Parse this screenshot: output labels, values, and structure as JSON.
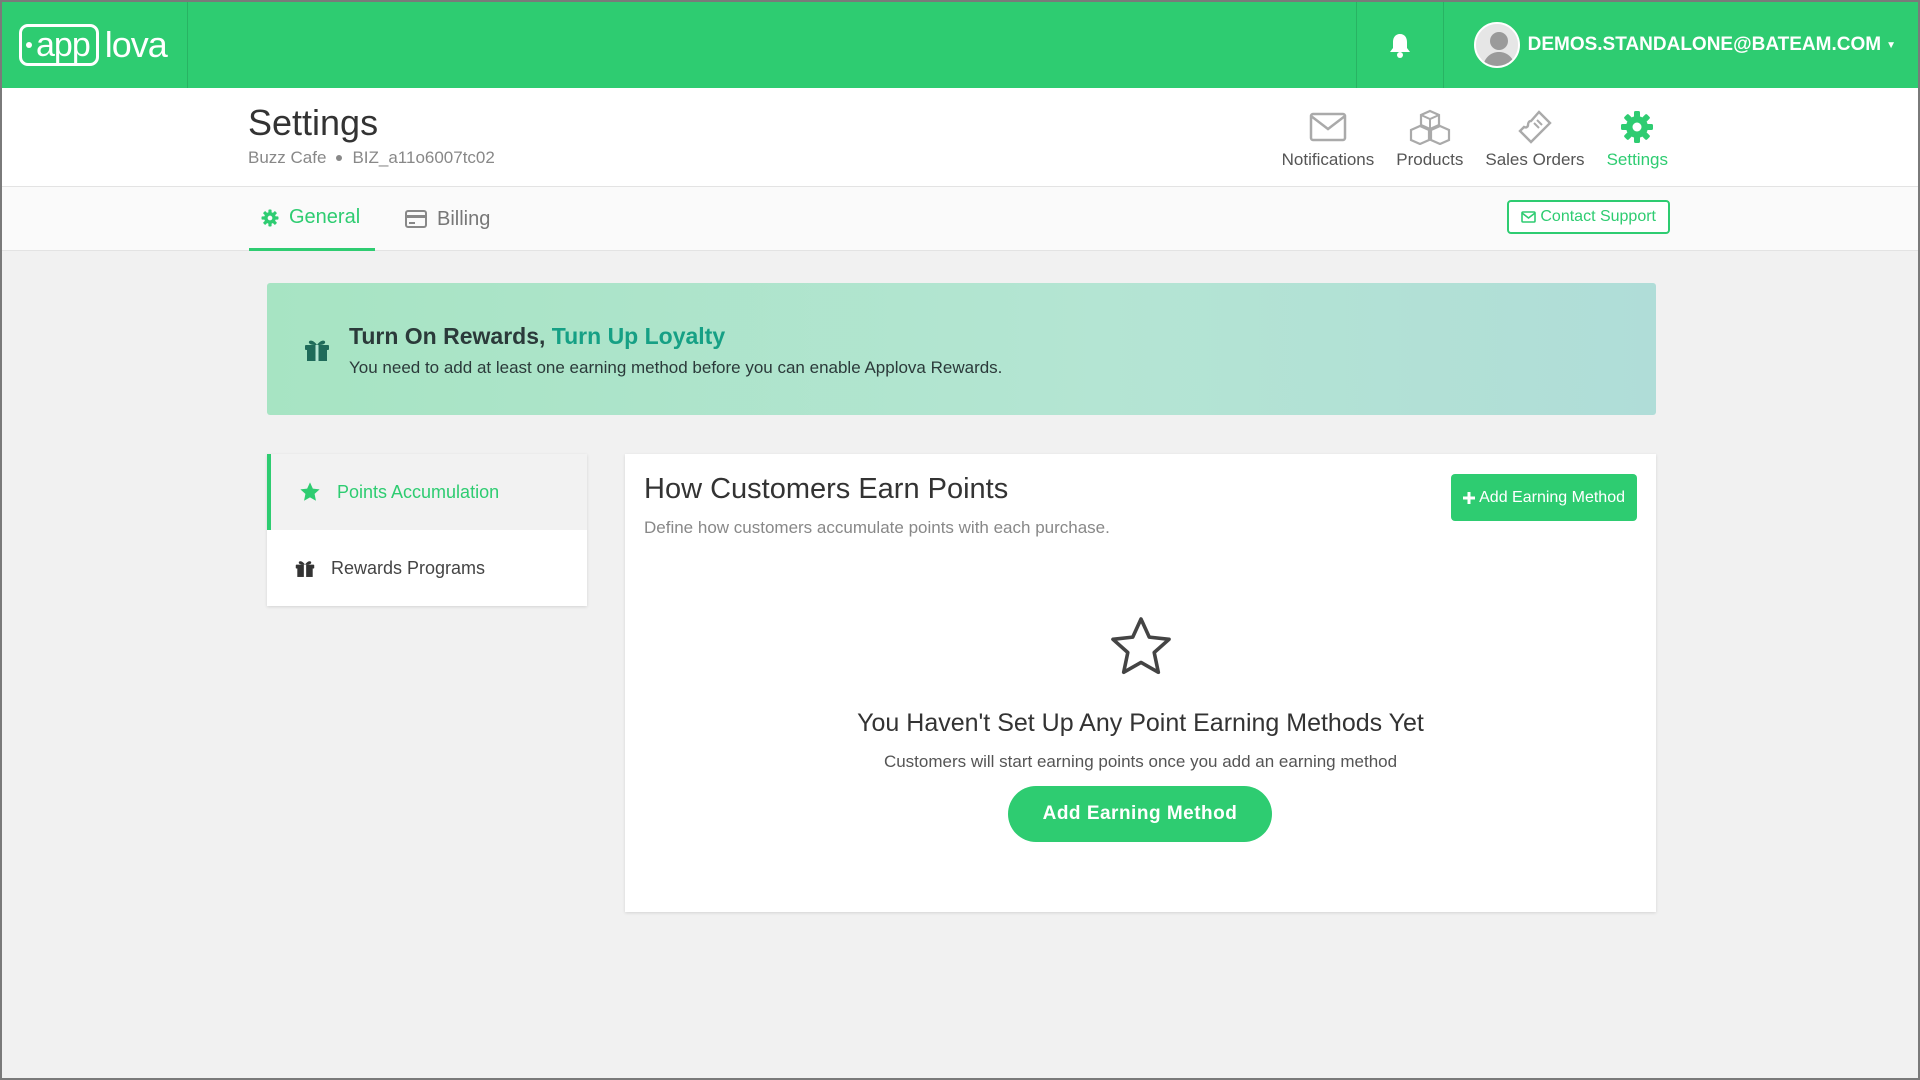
{
  "brand": {
    "logo_app": "app",
    "logo_lova": "lova",
    "color": "#2ecc71"
  },
  "topbar": {
    "user_email": "DEMOS.STANDALONE@BATEAM.COM"
  },
  "header": {
    "title": "Settings",
    "business_name": "Buzz Cafe",
    "business_id": "BIZ_a11o6007tc02",
    "nav": [
      {
        "label": "Notifications",
        "icon": "envelope-icon"
      },
      {
        "label": "Products",
        "icon": "boxes-icon"
      },
      {
        "label": "Sales Orders",
        "icon": "ticket-icon"
      },
      {
        "label": "Settings",
        "icon": "gear-icon",
        "active": true
      }
    ]
  },
  "tabs": {
    "general": "General",
    "billing": "Billing",
    "contact_support": "Contact Support"
  },
  "banner": {
    "title_strong": "Turn On Rewards,",
    "title_accent": "Turn Up Loyalty",
    "text": "You need to add at least one earning method before you can enable Applova Rewards."
  },
  "sidemenu": {
    "items": [
      {
        "label": "Points Accumulation",
        "icon": "star-icon",
        "active": true
      },
      {
        "label": "Rewards Programs",
        "icon": "gift-icon",
        "active": false
      }
    ]
  },
  "panel": {
    "title": "How Customers Earn Points",
    "subtitle": "Define how customers accumulate points with each purchase.",
    "add_button": "Add Earning Method",
    "empty_title": "You Haven't Set Up Any Point Earning Methods Yet",
    "empty_text": "Customers will start earning points once you add an earning method",
    "empty_button": "Add Earning Method"
  }
}
